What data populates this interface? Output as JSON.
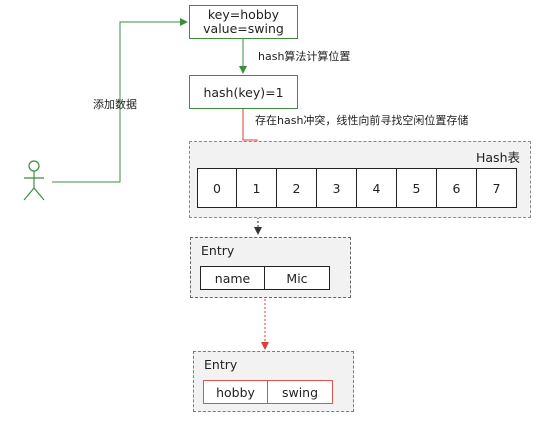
{
  "source_node": {
    "key_line": "key=hobby",
    "value_line": "value=swing"
  },
  "add_label": "添加数据",
  "hash_compute_label": "hash算法计算位置",
  "hash_result": "hash(key)=1",
  "collision_label": "存在hash冲突，线性向前寻找空闲位置存储",
  "hash_table": {
    "title": "Hash表",
    "slots": [
      "0",
      "1",
      "2",
      "3",
      "4",
      "5",
      "6",
      "7"
    ]
  },
  "entry_existing": {
    "title": "Entry",
    "key": "name",
    "value": "Mic"
  },
  "entry_new": {
    "title": "Entry",
    "key": "hobby",
    "value": "swing"
  },
  "colors": {
    "flow_green": "#3d8c40",
    "collision_red": "#e03c31",
    "neutral_dark": "#333333"
  }
}
